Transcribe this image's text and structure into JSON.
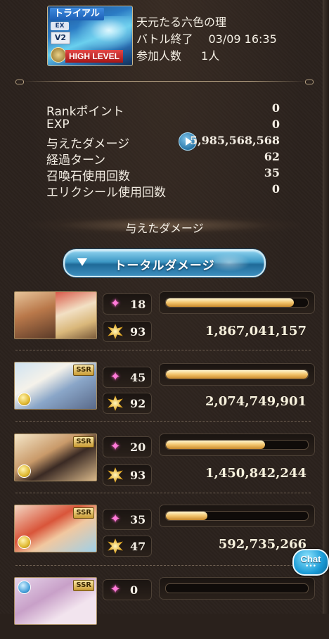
{
  "quest": {
    "trial_label": "トライアル",
    "ex_label": "EX",
    "version_label": "V2",
    "level_label": "HIGH LEVEL",
    "title": "天元たる六色の理",
    "battle_end_label": "バトル終了",
    "battle_end_time": "03/09 16:35",
    "participants_label": "参加人数",
    "participants_value": "1人"
  },
  "stats": [
    {
      "label": "Rankポイント",
      "value": "0"
    },
    {
      "label": "EXP",
      "value": "0"
    },
    {
      "label": "与えたダメージ",
      "value": "5,985,568,568"
    },
    {
      "label": "経過ターン",
      "value": "62"
    },
    {
      "label": "召喚石使用回数",
      "value": "35"
    },
    {
      "label": "エリクシール使用回数",
      "value": "0"
    }
  ],
  "damage_section": {
    "heading": "与えたダメージ",
    "total_button_label": "トータルダメージ"
  },
  "characters": [
    {
      "portrait": "main-character-pair",
      "skill_count": "18",
      "ca_count": "93",
      "damage": "1,867,041,157",
      "damage_ratio": 0.9,
      "element": "light"
    },
    {
      "portrait": "ssr-character-2",
      "ssr": "SSR",
      "skill_count": "45",
      "ca_count": "92",
      "damage": "2,074,749,901",
      "damage_ratio": 1.0,
      "element": "light"
    },
    {
      "portrait": "ssr-character-3",
      "ssr": "SSR",
      "skill_count": "20",
      "ca_count": "93",
      "damage": "1,450,842,244",
      "damage_ratio": 0.7,
      "element": "light"
    },
    {
      "portrait": "ssr-character-4",
      "ssr": "SSR",
      "skill_count": "35",
      "ca_count": "47",
      "damage": "592,735,266",
      "damage_ratio": 0.29,
      "element": "light"
    },
    {
      "portrait": "ssr-character-5",
      "ssr": "SSR",
      "skill_count": "0",
      "ca_count": "",
      "damage": "",
      "damage_ratio": 0.0,
      "element": "water"
    }
  ],
  "chat": {
    "label": "Chat",
    "dots": "•••"
  },
  "colors": {
    "accent_blue": "#3c97c4",
    "bar_gold": "#f2c46c",
    "background": "#2b221d",
    "skill_pink": "#ff7ad9"
  },
  "icons": {
    "play": "play-circle-icon",
    "skill": "pink-star-icon",
    "ca": "gold-burst-icon",
    "element_light": "light-element-icon",
    "element_water": "water-element-icon",
    "expand": "triangle-down-icon"
  }
}
